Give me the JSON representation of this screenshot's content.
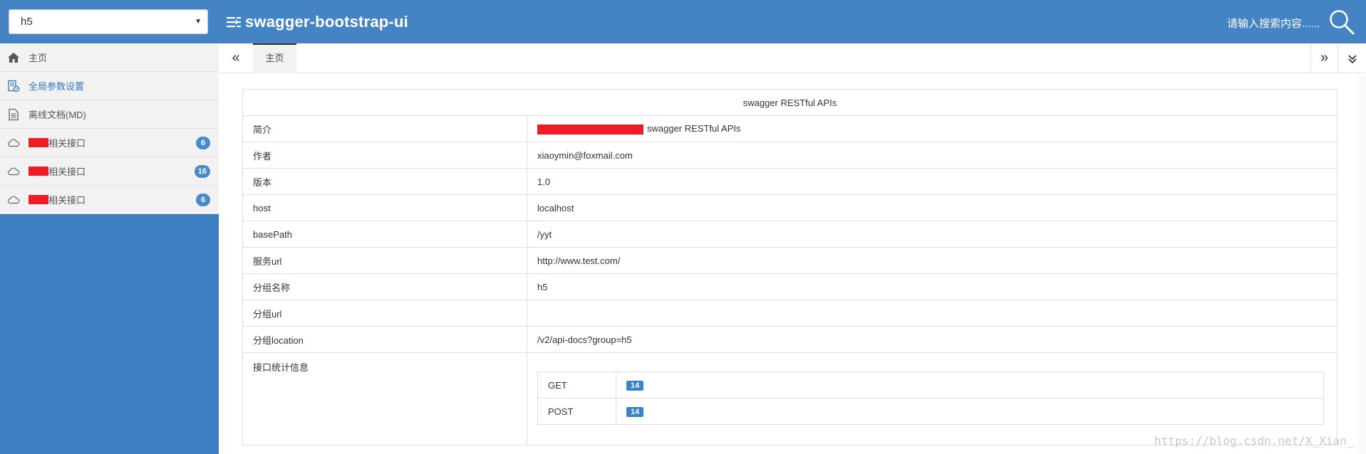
{
  "header": {
    "group_select": "h5",
    "brand_title": "swagger-bootstrap-ui",
    "search_placeholder": "请输入搜索内容......"
  },
  "sidebar": {
    "items": [
      {
        "label": "主页",
        "icon": "home-icon"
      },
      {
        "label": "全局参数设置",
        "icon": "settings-doc-icon"
      },
      {
        "label": "离线文档(MD)",
        "icon": "document-icon"
      },
      {
        "label": "相关接口",
        "icon": "cloud-icon",
        "count": "6"
      },
      {
        "label": "相关接口",
        "icon": "cloud-icon",
        "count": "16"
      },
      {
        "label": "相关接口",
        "icon": "cloud-icon",
        "count": "6"
      }
    ]
  },
  "tabs": {
    "prev": "«",
    "active": "主页",
    "next": "»"
  },
  "info": {
    "heading": "swagger RESTful APIs",
    "rows": [
      {
        "key": "简介",
        "value": "swagger RESTful APIs"
      },
      {
        "key": "作者",
        "value": "xiaoymin@foxmail.com"
      },
      {
        "key": "版本",
        "value": "1.0"
      },
      {
        "key": "host",
        "value": "localhost"
      },
      {
        "key": "basePath",
        "value": "/yyt"
      },
      {
        "key": "服务url",
        "value": "http://www.test.com/"
      },
      {
        "key": "分组名称",
        "value": "h5"
      },
      {
        "key": "分组url",
        "value": ""
      },
      {
        "key": "分组location",
        "value": "/v2/api-docs?group=h5"
      }
    ],
    "stats_label": "接口统计信息",
    "stats": [
      {
        "method": "GET",
        "count": "14"
      },
      {
        "method": "POST",
        "count": "14"
      }
    ]
  },
  "watermark": "https://blog.csdn.net/X_Xian_",
  "colors": {
    "header_bg": "#4584c4",
    "sidebar_bg": "#3d7fc1",
    "badge_bg": "#4a8ac9",
    "redaction": "#ee1c24"
  }
}
